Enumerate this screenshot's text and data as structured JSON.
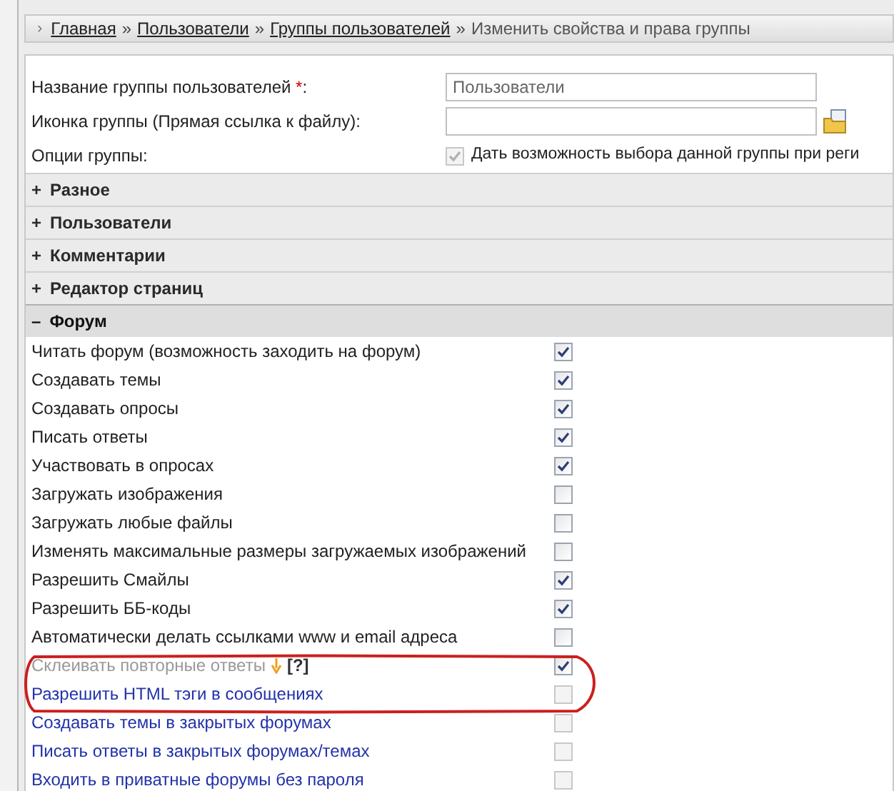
{
  "breadcrumb": {
    "lead": "›",
    "links": [
      "Главная",
      "Пользователи",
      "Группы пользователей"
    ],
    "separator": "»",
    "current": "Изменить свойства и права группы"
  },
  "fields": [
    {
      "kind": "text",
      "label": "Название группы пользователей",
      "required_mark": "*",
      "suffix": ":",
      "value": "Пользователи"
    },
    {
      "kind": "file",
      "label": "Иконка группы (Прямая ссылка к файлу)",
      "suffix": ":"
    },
    {
      "kind": "checkbox",
      "label": "Опции группы",
      "suffix": ":",
      "checked": true,
      "disabled": true,
      "option_label": "Дать возможность выбора данной группы при реги"
    }
  ],
  "sections": [
    {
      "toggle": "+",
      "title": "Разное",
      "expanded": false
    },
    {
      "toggle": "+",
      "title": "Пользователи",
      "expanded": false
    },
    {
      "toggle": "+",
      "title": "Комментарии",
      "expanded": false
    },
    {
      "toggle": "+",
      "title": "Редактор страниц",
      "expanded": false
    },
    {
      "toggle": "–",
      "title": "Форум",
      "expanded": true,
      "rows": [
        {
          "kind": "plain",
          "label": "Читать форум (возможность заходить на форум)",
          "checked": true
        },
        {
          "kind": "plain",
          "label": "Создавать темы",
          "checked": true
        },
        {
          "kind": "plain",
          "label": "Создавать опросы",
          "checked": true
        },
        {
          "kind": "plain",
          "label": "Писать ответы",
          "checked": true
        },
        {
          "kind": "plain",
          "label": "Участвовать в опросах",
          "checked": true
        },
        {
          "kind": "plain",
          "label": "Загружать изображения",
          "checked": false
        },
        {
          "kind": "plain",
          "label": "Загружать любые файлы",
          "checked": false
        },
        {
          "kind": "plain",
          "label": "Изменять максимальные размеры загружаемых изображений",
          "checked": false
        },
        {
          "kind": "plain",
          "label": "Разрешить Смайлы",
          "checked": true
        },
        {
          "kind": "plain",
          "label": "Разрешить ББ-коды",
          "checked": true
        },
        {
          "kind": "plain",
          "label": "Автоматически делать ссылками www и email адреса",
          "checked": false
        },
        {
          "kind": "dimmed",
          "label": "Склеивать повторные ответы",
          "help": "[?]",
          "checked": true
        },
        {
          "kind": "link",
          "label": "Разрешить HTML тэги в сообщениях",
          "checked": false
        },
        {
          "kind": "link",
          "label": "Создавать темы в закрытых форумах",
          "checked": false
        },
        {
          "kind": "link",
          "label": "Писать ответы в закрытых форумах/темах",
          "checked": false
        },
        {
          "kind": "link",
          "label": "Входить в приватные форумы без пароля",
          "checked": false
        }
      ]
    }
  ]
}
